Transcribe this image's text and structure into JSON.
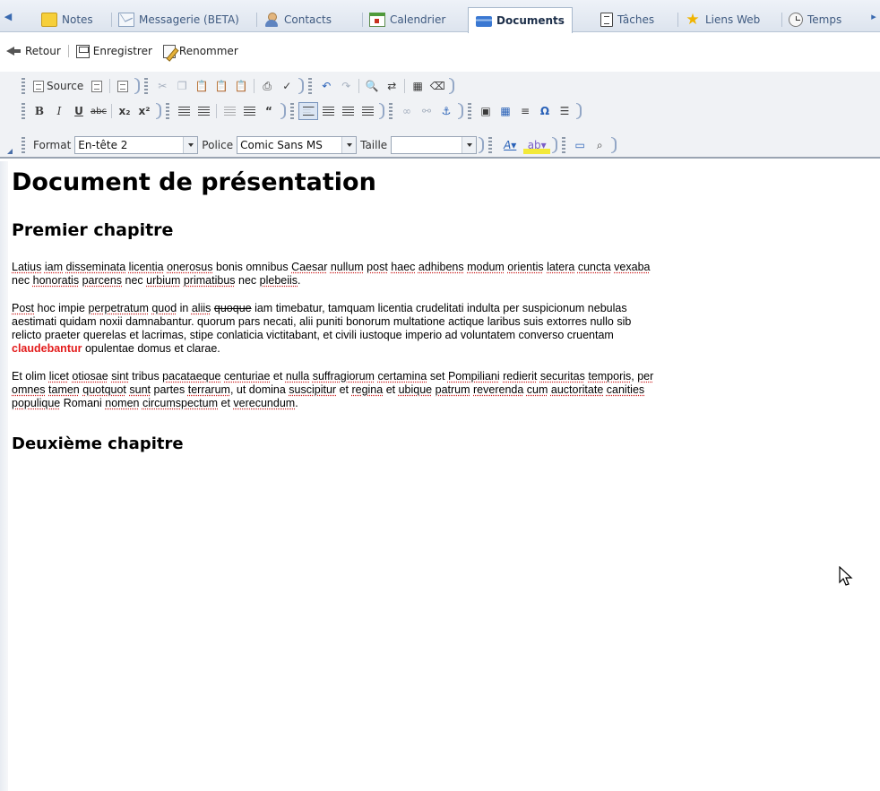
{
  "tabs": [
    {
      "label": "Notes",
      "icon": "notes-icon"
    },
    {
      "label": "Messagerie (BETA)",
      "icon": "mail-icon"
    },
    {
      "label": "Contacts",
      "icon": "contacts-icon"
    },
    {
      "label": "Calendrier",
      "icon": "calendar-icon"
    },
    {
      "label": "Documents",
      "icon": "documents-icon",
      "active": true
    },
    {
      "label": "Tâches",
      "icon": "tasks-icon"
    },
    {
      "label": "Liens Web",
      "icon": "star-icon"
    },
    {
      "label": "Temps",
      "icon": "clock-icon"
    }
  ],
  "actions": {
    "back": "Retour",
    "save": "Enregistrer",
    "rename": "Renommer"
  },
  "toolbar": {
    "source": "Source",
    "format_label": "Format",
    "format_value": "En-tête 2",
    "font_label": "Police",
    "font_value": "Comic Sans MS",
    "size_label": "Taille",
    "size_value": ""
  },
  "document": {
    "title": "Document de présentation",
    "chapter1": "Premier chapitre",
    "chapter2": "Deuxième chapitre"
  },
  "colors": {
    "accent": "#3a78d2",
    "highlight_word": "#e31b1b"
  }
}
